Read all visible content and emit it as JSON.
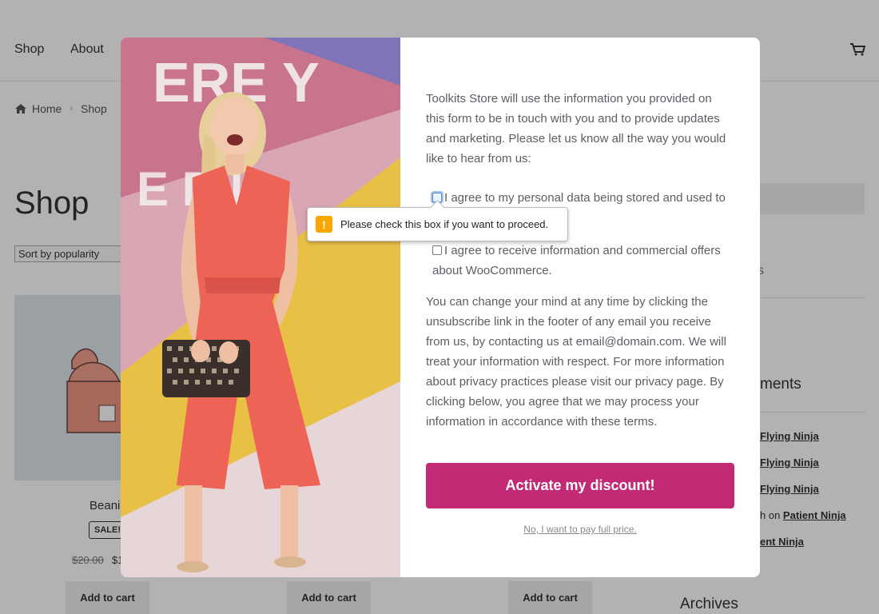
{
  "store": {
    "nav": {
      "shop": "Shop",
      "about": "About"
    },
    "breadcrumb": {
      "home": "Home",
      "shop": "Shop"
    },
    "page_title": "Shop",
    "sort_select": "Sort by popularity",
    "product": {
      "name_fragment": "Beani",
      "sale_badge": "SALE!",
      "old_price": "$20.00",
      "new_price_fragment": "$1"
    },
    "add_to_cart": "Add to cart",
    "sidebar": {
      "fragment_s": "s",
      "recent_comments_fragment": "ments",
      "comments": [
        {
          "prefix": "",
          "author": "Flying Ninja"
        },
        {
          "prefix": "",
          "author": "Flying Ninja"
        },
        {
          "prefix": "",
          "author": "Flying Ninja"
        },
        {
          "prefix": "h on ",
          "author": "Patient Ninja"
        },
        {
          "prefix": "",
          "author": "ent Ninja"
        }
      ],
      "archives": "Archives"
    }
  },
  "modal": {
    "intro": "Toolkits Store will use the information you provided on this form to be in touch with you and to provide updates and marketing. Please let us know all the way you would like to hear from us:",
    "consent_1": "I agree to my personal data being stored and used to",
    "consent_2": "I agree to receive information and commercial offers about WooCommerce.",
    "privacy": "You can change your mind at any time by clicking the unsubscribe link in the footer of any email you receive from us, by contacting us at email@domain.com. We will treat your information with respect. For more information about privacy practices please visit our privacy page. By clicking below, you agree that we may process your information in accordance with these terms.",
    "tooltip": "Please check this box if you want to proceed.",
    "tooltip_icon": "!",
    "cta": "Activate my discount!",
    "decline": "No, I want to pay full price.",
    "colors": {
      "cta": "#c32a76",
      "warning": "#f9a600"
    }
  }
}
